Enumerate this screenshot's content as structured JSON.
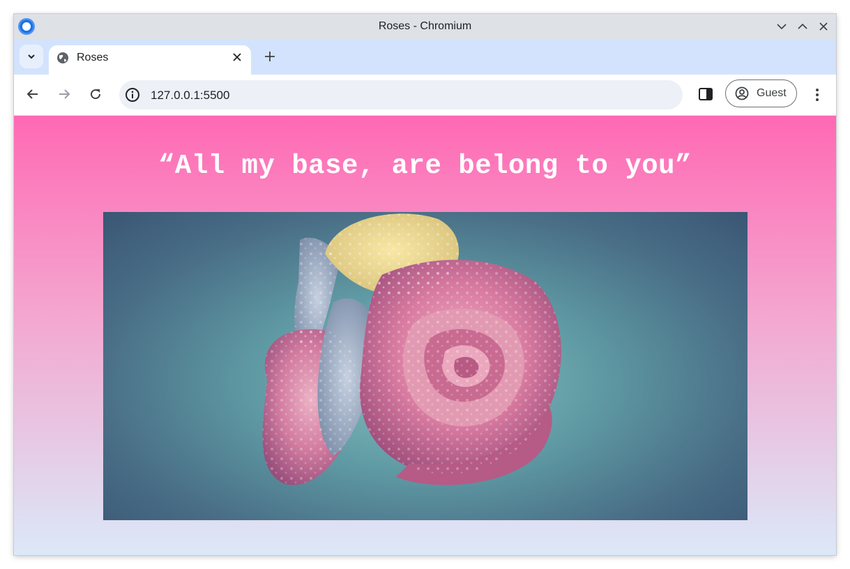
{
  "window": {
    "title": "Roses - Chromium"
  },
  "tabs": [
    {
      "title": "Roses",
      "active": true
    }
  ],
  "toolbar": {
    "url": "127.0.0.1:5500",
    "profile_label": "Guest"
  },
  "page": {
    "headline": "“All my base, are belong to you”",
    "image": {
      "subject": "rose",
      "colors": {
        "background": "#5f9aa4",
        "petals_main": "#d87aa0",
        "petals_yellow": "#f1dc8a",
        "petals_blue": "#a7b6cc"
      }
    },
    "gradient": {
      "top": "#ff69b4",
      "middle": "#f4a6cf",
      "bottom": "#dbe8f8"
    }
  },
  "icons": {
    "app": "chromium-icon",
    "tab_search": "chevron-down-icon",
    "favicon": "globe-icon",
    "tab_close": "close-icon",
    "new_tab": "plus-icon",
    "back": "arrow-left-icon",
    "forward": "arrow-right-icon",
    "reload": "reload-icon",
    "site_info": "info-icon",
    "side_panel": "side-panel-icon",
    "profile": "account-circle-icon",
    "menu": "kebab-menu-icon"
  }
}
